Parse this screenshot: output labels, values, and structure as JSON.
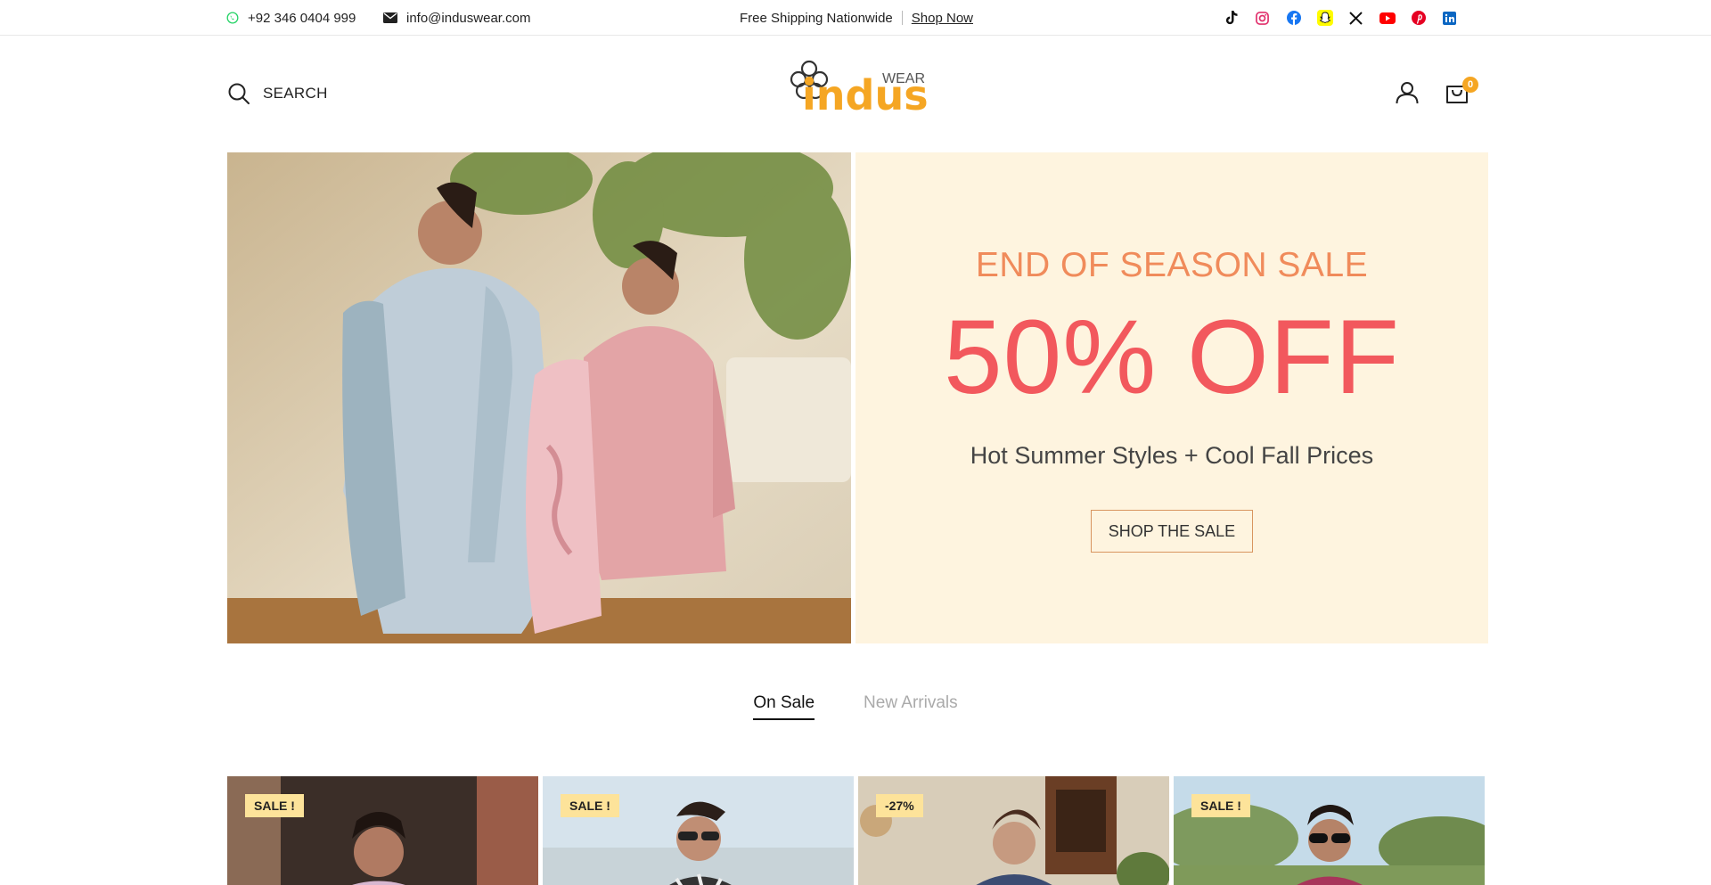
{
  "topbar": {
    "phone": "+92 346 0404 999",
    "email": "info@induswear.com",
    "promo_text": "Free Shipping Nationwide",
    "promo_link": "Shop Now",
    "socials": [
      {
        "name": "tiktok-icon",
        "color": "#111111"
      },
      {
        "name": "instagram-icon",
        "color": "#e1306c"
      },
      {
        "name": "facebook-icon",
        "color": "#1877f2"
      },
      {
        "name": "snapchat-icon",
        "color": "#fffc00"
      },
      {
        "name": "x-icon",
        "color": "#111111"
      },
      {
        "name": "youtube-icon",
        "color": "#ff0000"
      },
      {
        "name": "pinterest-icon",
        "color": "#e60023"
      },
      {
        "name": "linkedin-icon",
        "color": "#0a66c2"
      }
    ]
  },
  "header": {
    "search_label": "SEARCH",
    "logo_main": "indus",
    "logo_sub": "WEAR",
    "cart_count": "0"
  },
  "hero": {
    "kicker": "END OF SEASON SALE",
    "headline": "50% OFF",
    "subtitle": "Hot Summer Styles + Cool Fall Prices",
    "cta": "SHOP THE SALE",
    "colors": {
      "panel_bg": "#fef4df",
      "kicker": "#f08b5b",
      "headline": "#f2585d"
    }
  },
  "tabs": [
    {
      "label": "On Sale",
      "active": true
    },
    {
      "label": "New Arrivals",
      "active": false
    }
  ],
  "products": [
    {
      "badge": "SALE !"
    },
    {
      "badge": "SALE !"
    },
    {
      "badge": "-27%"
    },
    {
      "badge": "SALE !"
    }
  ]
}
